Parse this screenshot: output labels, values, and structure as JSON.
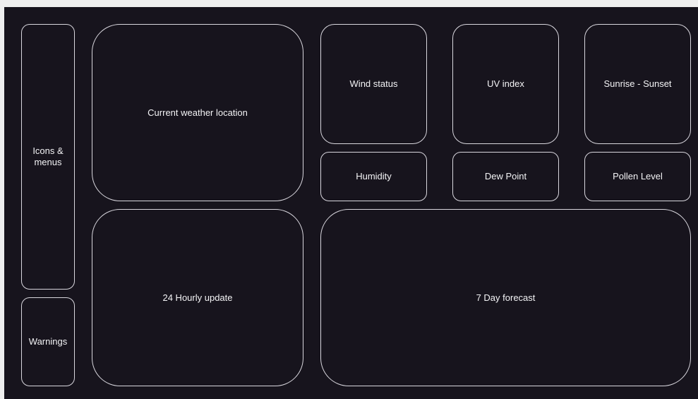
{
  "panels": {
    "icons_menus": "Icons &\nmenus",
    "warnings": "Warnings",
    "current_weather": "Current weather location",
    "hourly": "24 Hourly update",
    "wind": "Wind status",
    "uv": "UV index",
    "sun": "Sunrise - Sunset",
    "humidity": "Humidity",
    "dew": "Dew Point",
    "pollen": "Pollen Level",
    "forecast": "7 Day forecast"
  },
  "colors": {
    "canvas_bg": "#17141d",
    "page_bg": "#efefef",
    "border": "#d9d7de",
    "text": "#f4f4f6"
  }
}
